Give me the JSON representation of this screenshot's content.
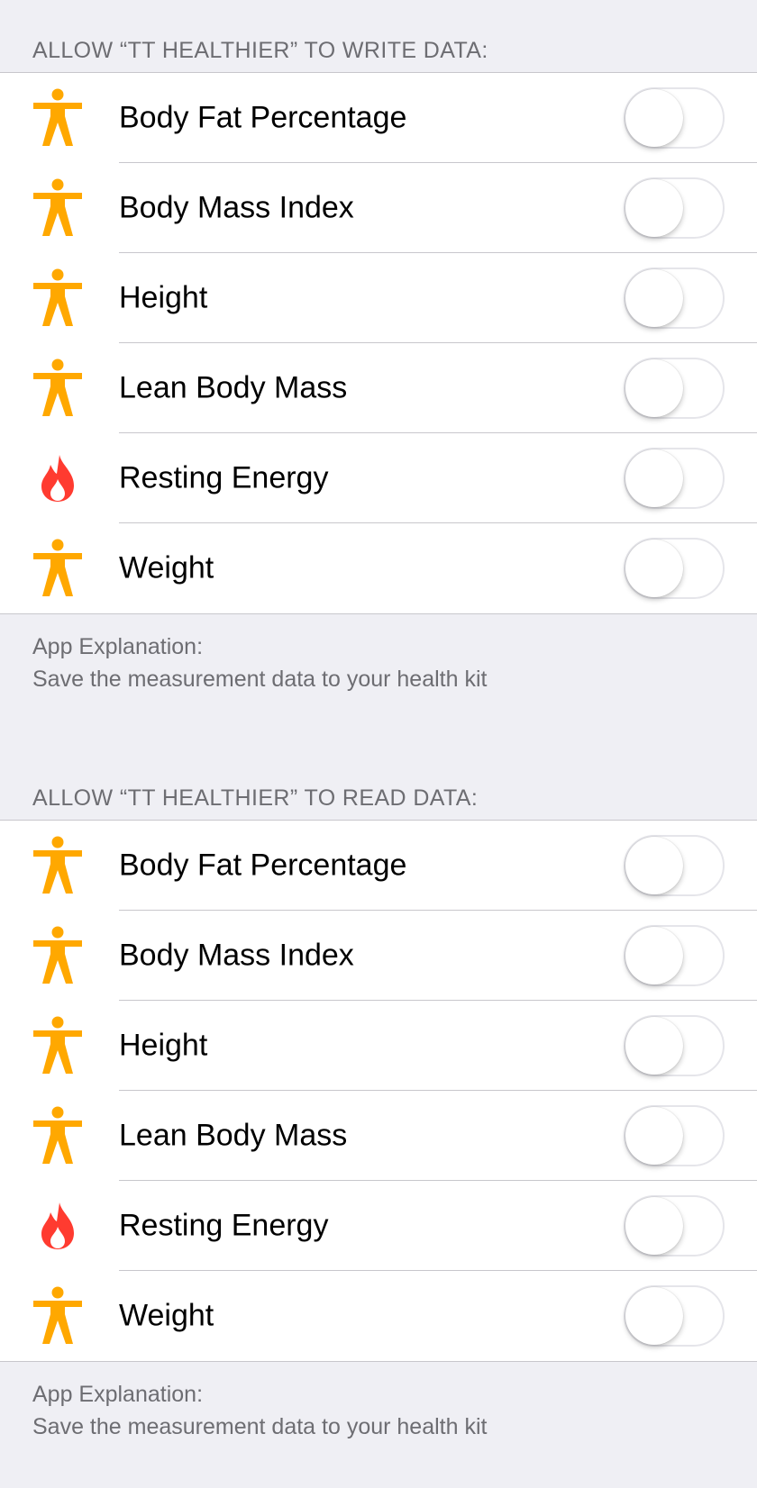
{
  "write_section": {
    "header": "ALLOW “TT HEALTHIER” TO WRITE DATA:",
    "items": [
      {
        "label": "Body Fat Percentage",
        "icon": "figure-icon",
        "enabled": false
      },
      {
        "label": "Body Mass Index",
        "icon": "figure-icon",
        "enabled": false
      },
      {
        "label": "Height",
        "icon": "figure-icon",
        "enabled": false
      },
      {
        "label": "Lean Body Mass",
        "icon": "figure-icon",
        "enabled": false
      },
      {
        "label": "Resting Energy",
        "icon": "flame-icon",
        "enabled": false
      },
      {
        "label": "Weight",
        "icon": "figure-icon",
        "enabled": false
      }
    ],
    "footer_title": "App Explanation:",
    "footer_text": "Save the measurement data to your health kit"
  },
  "read_section": {
    "header": "ALLOW “TT HEALTHIER” TO READ DATA:",
    "items": [
      {
        "label": "Body Fat Percentage",
        "icon": "figure-icon",
        "enabled": false
      },
      {
        "label": "Body Mass Index",
        "icon": "figure-icon",
        "enabled": false
      },
      {
        "label": "Height",
        "icon": "figure-icon",
        "enabled": false
      },
      {
        "label": "Lean Body Mass",
        "icon": "figure-icon",
        "enabled": false
      },
      {
        "label": "Resting Energy",
        "icon": "flame-icon",
        "enabled": false
      },
      {
        "label": "Weight",
        "icon": "figure-icon",
        "enabled": false
      }
    ],
    "footer_title": "App Explanation:",
    "footer_text": "Save the measurement data to your health kit"
  },
  "colors": {
    "figure_icon": "#ffa800",
    "flame_icon": "#ff3b30",
    "background": "#efeff4",
    "secondary_text": "#6d6d72"
  }
}
